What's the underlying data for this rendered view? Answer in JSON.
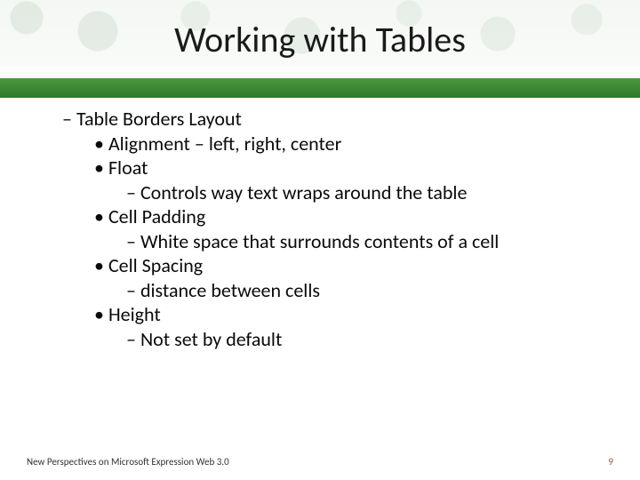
{
  "title": "Working with Tables",
  "body": {
    "heading": "Table Borders Layout",
    "items": [
      {
        "label": "Alignment – left, right, center",
        "sub": null
      },
      {
        "label": "Float",
        "sub": "Controls way text wraps around the table"
      },
      {
        "label": "Cell Padding",
        "sub": "White space that surrounds contents of a cell"
      },
      {
        "label": "Cell Spacing",
        "sub": "distance between cells"
      },
      {
        "label": "Height",
        "sub": "Not set by default"
      }
    ]
  },
  "footer": {
    "left": "New Perspectives on Microsoft Expression Web 3.0",
    "page": "9"
  }
}
